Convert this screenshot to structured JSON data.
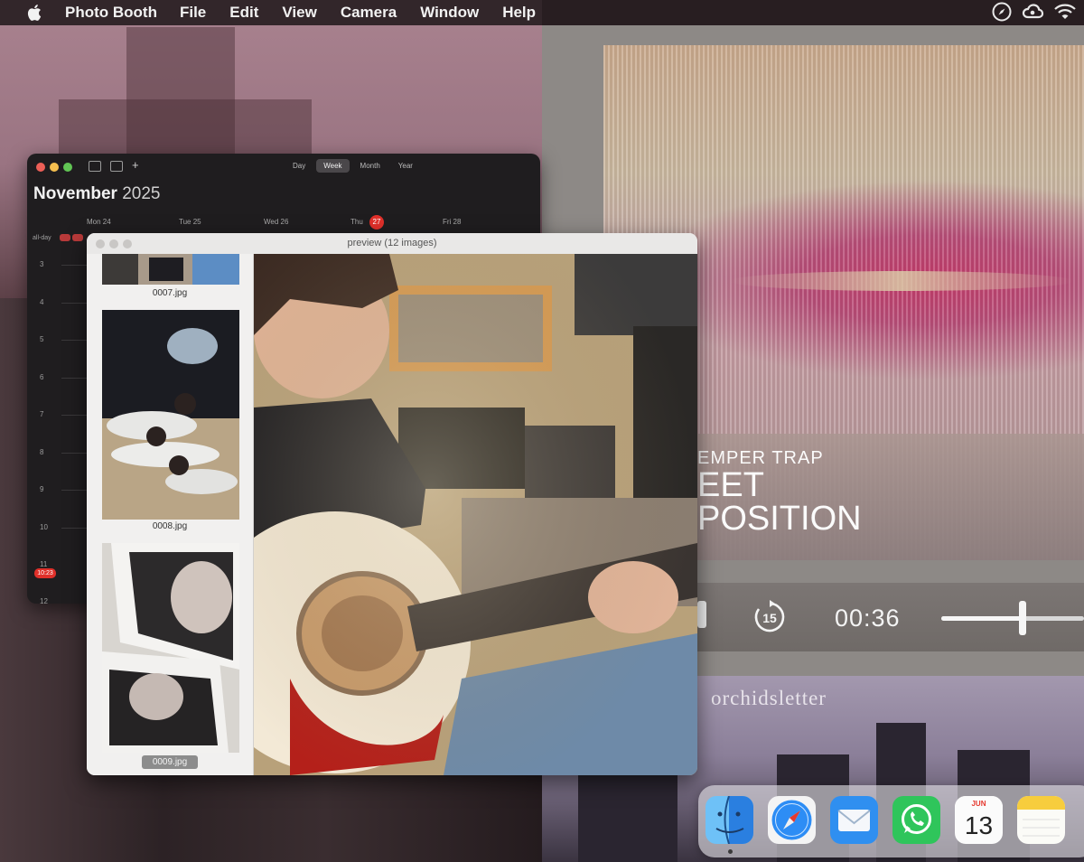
{
  "menubar": {
    "app_name": "Photo Booth",
    "items": [
      "File",
      "Edit",
      "View",
      "Camera",
      "Window",
      "Help"
    ],
    "status_icons": [
      "compass-icon",
      "creative-cloud-icon",
      "wifi-icon"
    ]
  },
  "calendar": {
    "month": "November",
    "year": "2025",
    "views": [
      "Day",
      "Week",
      "Month",
      "Year"
    ],
    "active_view": "Week",
    "days": [
      "Mon 24",
      "Tue 25",
      "Wed 26",
      "Thu",
      "Fri 28"
    ],
    "today_day": "27",
    "today_label": "Thu",
    "all_day_label": "all-day",
    "hours": [
      "3",
      "4",
      "5",
      "6",
      "7",
      "8",
      "9",
      "10",
      "11",
      "12"
    ],
    "now_time": "10:23"
  },
  "preview": {
    "title": "preview (12 images)",
    "thumbnails": [
      {
        "label": "0007.jpg",
        "selected": false
      },
      {
        "label": "0008.jpg",
        "selected": false
      },
      {
        "label": "0009.jpg",
        "selected": true
      }
    ]
  },
  "player": {
    "artist": "EMPER TRAP",
    "title_line1": "EET",
    "title_line2": "POSITION",
    "time": "00:36",
    "skip_seconds": "15",
    "volume_level": 0.57
  },
  "watermark": "orchidsletter",
  "dock": {
    "apps": [
      "Finder",
      "Safari",
      "Mail",
      "WhatsApp",
      "Calendar",
      "Notes"
    ],
    "calendar_month": "JUN",
    "calendar_day": "13"
  },
  "colors": {
    "accent_red": "#e0302a",
    "menubar_bg": "#281e22",
    "preview_bg": "#ecebea"
  }
}
